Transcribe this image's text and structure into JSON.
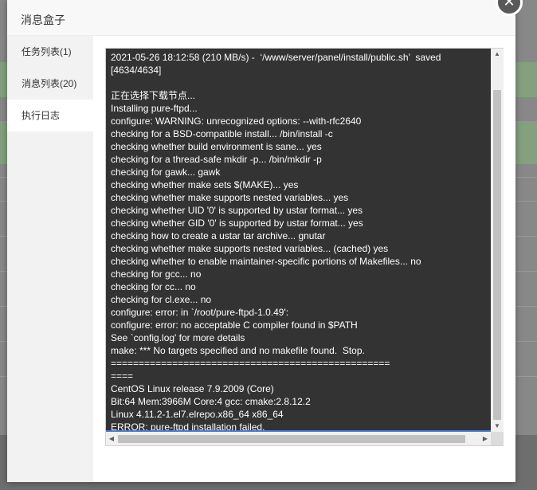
{
  "dialog": {
    "title": "消息盒子",
    "close_glyph": "✕"
  },
  "sidebar": {
    "items": [
      {
        "label": "任务列表(1)"
      },
      {
        "label": "消息列表(20)"
      },
      {
        "label": "执行日志"
      }
    ]
  },
  "log": {
    "lines": [
      "2021-05-26 18:12:58 (210 MB/s) -  ‘/www/server/panel/install/public.sh’  saved",
      "[4634/4634]",
      "",
      "正在选择下载节点...",
      "Installing pure-ftpd...",
      "configure: WARNING: unrecognized options: --with-rfc2640",
      "checking for a BSD-compatible install... /bin/install -c",
      "checking whether build environment is sane... yes",
      "checking for a thread-safe mkdir -p... /bin/mkdir -p",
      "checking for gawk... gawk",
      "checking whether make sets $(MAKE)... yes",
      "checking whether make supports nested variables... yes",
      "checking whether UID '0' is supported by ustar format... yes",
      "checking whether GID '0' is supported by ustar format... yes",
      "checking how to create a ustar tar archive... gnutar",
      "checking whether make supports nested variables... (cached) yes",
      "checking whether to enable maintainer-specific portions of Makefiles... no",
      "checking for gcc... no",
      "checking for cc... no",
      "checking for cl.exe... no",
      "configure: error: in `/root/pure-ftpd-1.0.49':",
      "configure: error: no acceptable C compiler found in $PATH",
      "See `config.log' for more details",
      "make: *** No targets specified and no makefile found.  Stop.",
      "==================================================",
      "====",
      "CentOS Linux release 7.9.2009 (Core)",
      "Bit:64 Mem:3966M Core:4 gcc: cmake:2.8.12.2",
      "Linux 4.11.2-1.el7.elrepo.x86_64 x86_64",
      "ERROR: pure-ftpd installation failed."
    ]
  },
  "scrollbar": {
    "up_glyph": "▲",
    "down_glyph": "▼",
    "left_glyph": "◀",
    "right_glyph": "▶"
  },
  "colors": {
    "terminal_bg": "#333333",
    "terminal_fg": "#ffffff",
    "close_bg": "#595959"
  }
}
